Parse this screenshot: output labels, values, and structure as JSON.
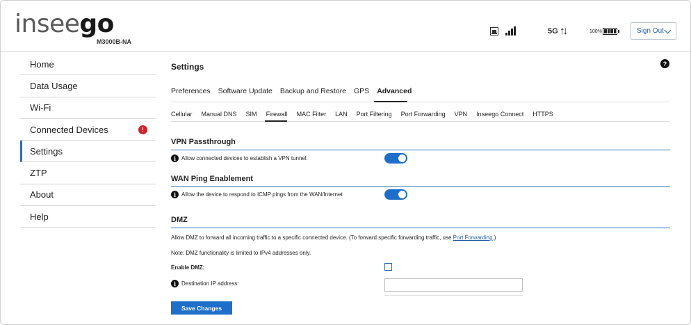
{
  "header": {
    "logo_main": "insee",
    "logo_accent": "go",
    "model": "M3000B-NA",
    "network": "5G",
    "network_arrows": "↑↓",
    "battery_percent": "100%",
    "sign_out_label": "Sign Out",
    "icons": {
      "ethernet": "ethernet-icon",
      "signal": "signal-bars-icon",
      "battery": "battery-full-icon",
      "dropdown": "chevron-down-icon"
    }
  },
  "sidebar": {
    "items": [
      {
        "label": "Home"
      },
      {
        "label": "Data Usage"
      },
      {
        "label": "Wi-Fi"
      },
      {
        "label": "Connected Devices",
        "badge": "!"
      },
      {
        "label": "Settings",
        "active": true
      },
      {
        "label": "ZTP"
      },
      {
        "label": "About"
      },
      {
        "label": "Help"
      }
    ]
  },
  "main": {
    "title": "Settings",
    "help_icon": "?",
    "tabs": [
      "Preferences",
      "Software Update",
      "Backup and Restore",
      "GPS",
      "Advanced"
    ],
    "active_tab": "Advanced",
    "subtabs": [
      "Cellular",
      "Manual DNS",
      "SIM",
      "Firewall",
      "MAC Filter",
      "LAN",
      "Port Filtering",
      "Port Forwarding",
      "VPN",
      "Inseego Connect",
      "HTTPS"
    ],
    "active_subtab": "Firewall",
    "vpn": {
      "title": "VPN Passthrough",
      "desc": "Allow connected devices to establish a VPN tunnel:",
      "enabled": true
    },
    "wan_ping": {
      "title": "WAN Ping Enablement",
      "desc": "Allow the device to respond to ICMP pings from the WAN/Internet",
      "enabled": true
    },
    "dmz": {
      "title": "DMZ",
      "desc_before": "Allow DMZ to forward all incoming traffic to a specific connected device. (To forward specific forwarding traffic, use ",
      "desc_link": "Port Forwarding",
      "desc_after": ".)",
      "note": "Note: DMZ functionality is limited to IPv4 addresses only.",
      "enable_label": "Enable DMZ:",
      "enabled": false,
      "ip_label": "Destination IP address:",
      "ip_value": ""
    },
    "save_label": "Save Changes",
    "info_icon": "i"
  },
  "colors": {
    "accent": "#1d6fc9",
    "link": "#1f5ea8",
    "badge": "#d0232a"
  }
}
